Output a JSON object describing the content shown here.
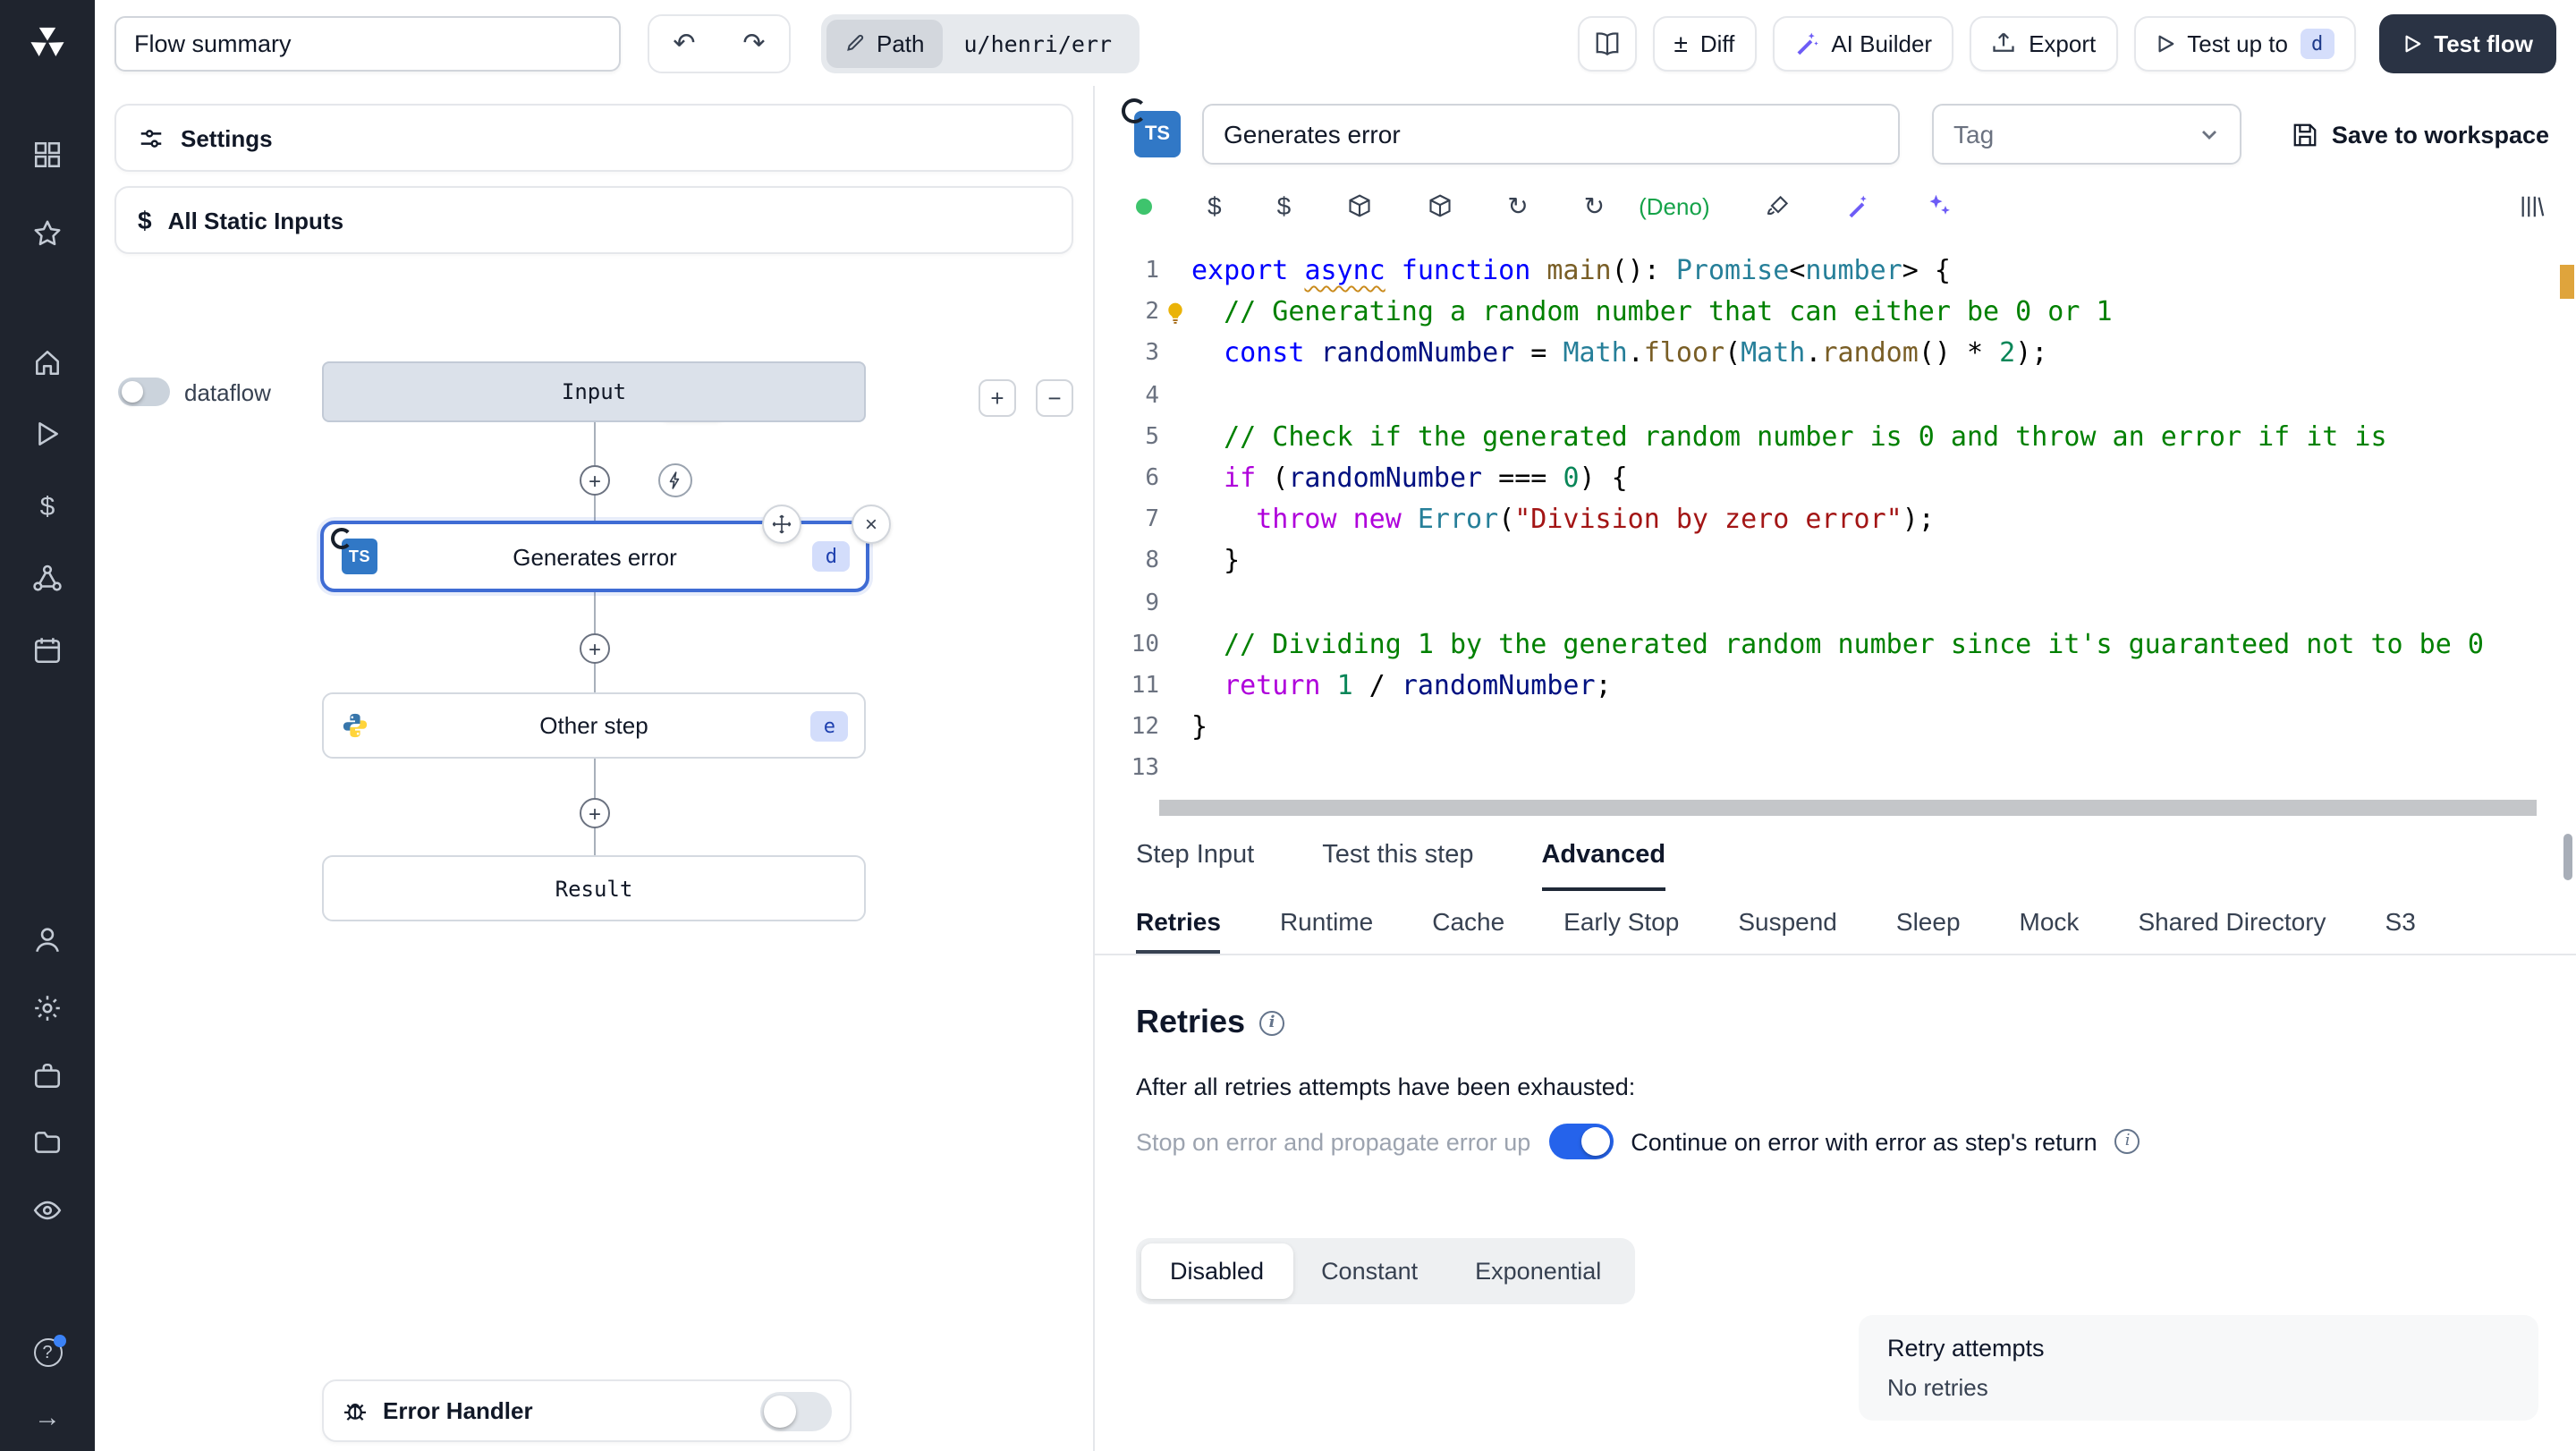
{
  "topbar": {
    "flow_summary": "Flow summary",
    "path_label": "Path",
    "path_value": "u/henri/err",
    "diff": "Diff",
    "ai_builder": "AI Builder",
    "export": "Export",
    "test_up_to": "Test up to",
    "test_up_to_badge": "d",
    "test_flow": "Test flow"
  },
  "flow_panel": {
    "settings": "Settings",
    "all_static_inputs": "All Static Inputs",
    "dataflow": "dataflow",
    "nodes": {
      "input": "Input",
      "step_d_label": "Generates error",
      "step_d_badge": "d",
      "step_e_label": "Other step",
      "step_e_badge": "e",
      "result": "Result"
    },
    "error_handler": "Error Handler"
  },
  "step_editor": {
    "name": "Generates error",
    "tag_placeholder": "Tag",
    "save": "Save to workspace",
    "lang": "(Deno)",
    "code": [
      [
        [
          "kw",
          "export "
        ],
        [
          "kwu",
          "async"
        ],
        [
          "kw",
          " function"
        ],
        [
          "p",
          " "
        ],
        [
          "fn",
          "main"
        ],
        [
          "p",
          "(): "
        ],
        [
          "ty",
          "Promise"
        ],
        [
          "p",
          "<"
        ],
        [
          "ty",
          "number"
        ],
        [
          "p",
          "> {"
        ]
      ],
      [
        [
          "p",
          "  "
        ],
        [
          "cm",
          "// Generating a random number that can either be 0 or 1"
        ]
      ],
      [
        [
          "p",
          "  "
        ],
        [
          "kw",
          "const"
        ],
        [
          "p",
          " "
        ],
        [
          "vr",
          "randomNumber"
        ],
        [
          "p",
          " = "
        ],
        [
          "ty",
          "Math"
        ],
        [
          "p",
          "."
        ],
        [
          "fn",
          "floor"
        ],
        [
          "p",
          "("
        ],
        [
          "ty",
          "Math"
        ],
        [
          "p",
          "."
        ],
        [
          "fn",
          "random"
        ],
        [
          "p",
          "() * "
        ],
        [
          "nm",
          "2"
        ],
        [
          "p",
          ");"
        ]
      ],
      [],
      [
        [
          "p",
          "  "
        ],
        [
          "cm",
          "// Check if the generated random number is 0 and throw an error if it is"
        ]
      ],
      [
        [
          "p",
          "  "
        ],
        [
          "ct",
          "if"
        ],
        [
          "p",
          " ("
        ],
        [
          "vr",
          "randomNumber"
        ],
        [
          "p",
          " === "
        ],
        [
          "nm",
          "0"
        ],
        [
          "p",
          ") {"
        ]
      ],
      [
        [
          "p",
          "    "
        ],
        [
          "ct",
          "throw"
        ],
        [
          "p",
          " "
        ],
        [
          "ct",
          "new"
        ],
        [
          "p",
          " "
        ],
        [
          "ty",
          "Error"
        ],
        [
          "p",
          "("
        ],
        [
          "st",
          "\"Division by zero error\""
        ],
        [
          "p",
          ");"
        ]
      ],
      [
        [
          "p",
          "  }"
        ]
      ],
      [],
      [
        [
          "p",
          "  "
        ],
        [
          "cm",
          "// Dividing 1 by the generated random number since it's guaranteed not to be 0"
        ]
      ],
      [
        [
          "p",
          "  "
        ],
        [
          "ct",
          "return"
        ],
        [
          "p",
          " "
        ],
        [
          "nm",
          "1"
        ],
        [
          "p",
          " / "
        ],
        [
          "vr",
          "randomNumber"
        ],
        [
          "p",
          ";"
        ]
      ],
      [
        [
          "p",
          "}"
        ]
      ],
      []
    ]
  },
  "tabs": {
    "items": [
      "Step Input",
      "Test this step",
      "Advanced"
    ],
    "selected": "Advanced"
  },
  "subtabs": {
    "items": [
      "Retries",
      "Runtime",
      "Cache",
      "Early Stop",
      "Suspend",
      "Sleep",
      "Mock",
      "Shared Directory",
      "S3"
    ],
    "selected": "Retries"
  },
  "retries": {
    "title": "Retries",
    "exhausted": "After all retries attempts have been exhausted:",
    "stop_option": "Stop on error and propagate error up",
    "continue_option": "Continue on error with error as step's return",
    "modes": {
      "items": [
        "Disabled",
        "Constant",
        "Exponential"
      ],
      "selected": "Disabled"
    },
    "attempts_label": "Retry attempts",
    "attempts_value": "No retries"
  },
  "icons": {
    "undo": "↶",
    "redo": "↷",
    "diff": "±",
    "close": "×",
    "dollar": "$",
    "reload": "↻",
    "arrow_right": "→",
    "question": "?",
    "zoom_in": "+",
    "zoom_out": "−",
    "ts": "TS"
  },
  "colors": {
    "accent_blue": "#3f6cd4",
    "toggle_on": "#2563eb",
    "dark_button": "#2a3344",
    "ts_blue": "#3178c6",
    "lang_green": "#16a34a"
  }
}
